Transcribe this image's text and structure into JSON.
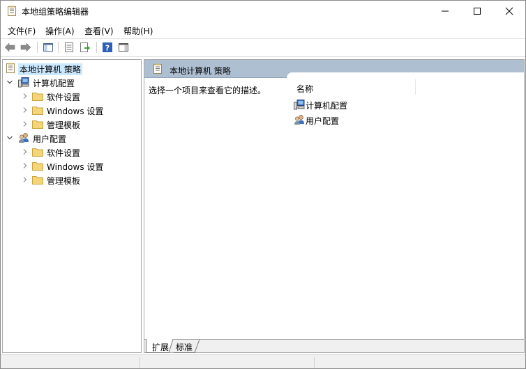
{
  "window": {
    "title": "本地组策略编辑器"
  },
  "menu": [
    "文件(F)",
    "操作(A)",
    "查看(V)",
    "帮助(H)"
  ],
  "toolbar": {
    "buttons": [
      "back-arrow-icon",
      "forward-arrow-icon",
      "show-hide-tree-icon",
      "properties-icon",
      "export-list-icon",
      "help-icon",
      "show-hide-action-pane-icon"
    ]
  },
  "tree": {
    "root": "本地计算机 策略",
    "computer_config": "计算机配置",
    "user_config": "用户配置",
    "software_settings": "软件设置",
    "windows_settings": "Windows 设置",
    "admin_templates": "管理模板"
  },
  "right": {
    "header": "本地计算机 策略",
    "description": "选择一个项目来查看它的描述。",
    "column_name": "名称",
    "items": [
      "计算机配置",
      "用户配置"
    ]
  },
  "tabs": [
    "扩展",
    "标准"
  ],
  "colors": {
    "header_bg": "#aebfd2",
    "selection": "#cce8ff",
    "folder": "#e8c25a"
  }
}
